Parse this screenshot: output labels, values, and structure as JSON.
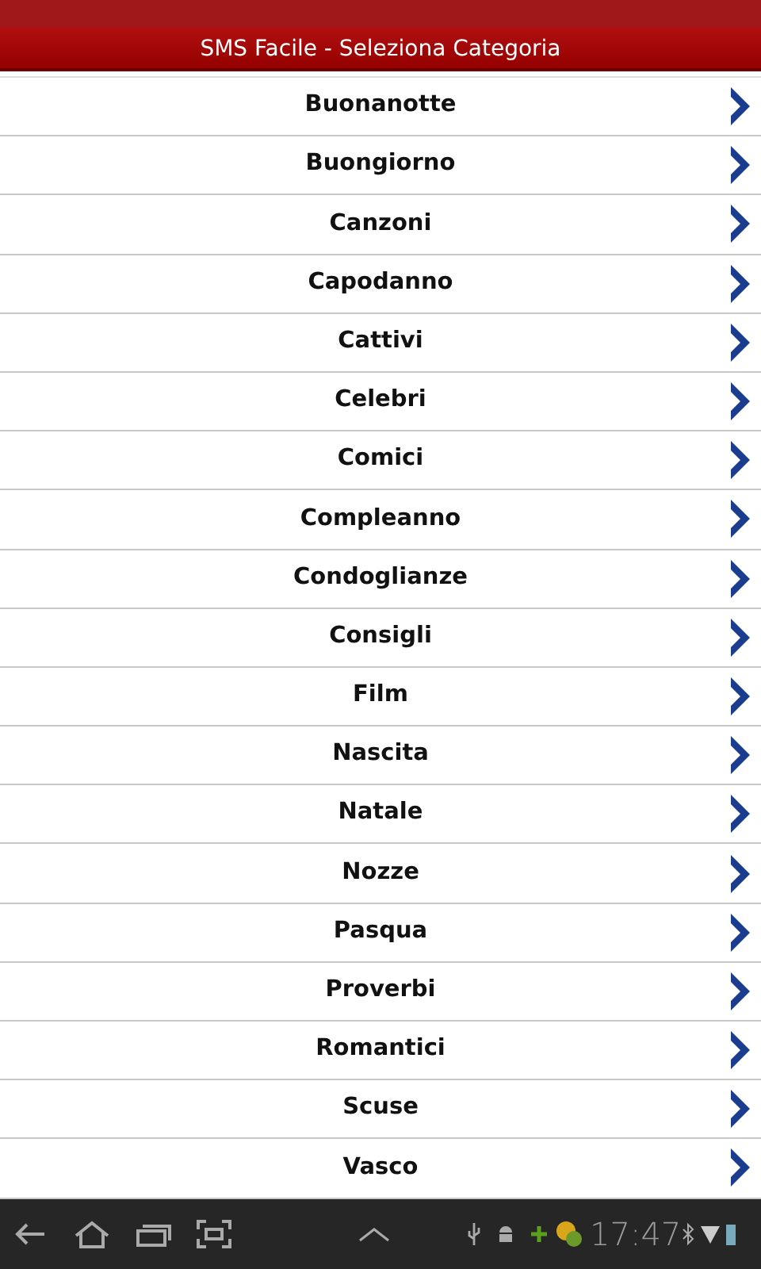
{
  "title_bar": {
    "title": "SMS Facile - Seleziona Categoria"
  },
  "categories": [
    {
      "label": "Buonanotte"
    },
    {
      "label": "Buongiorno"
    },
    {
      "label": "Canzoni"
    },
    {
      "label": "Capodanno"
    },
    {
      "label": "Cattivi"
    },
    {
      "label": "Celebri"
    },
    {
      "label": "Comici"
    },
    {
      "label": "Compleanno"
    },
    {
      "label": "Condoglianze"
    },
    {
      "label": "Consigli"
    },
    {
      "label": "Film"
    },
    {
      "label": "Nascita"
    },
    {
      "label": "Natale"
    },
    {
      "label": "Nozze"
    },
    {
      "label": "Pasqua"
    },
    {
      "label": "Proverbi"
    },
    {
      "label": "Romantici"
    },
    {
      "label": "Scuse"
    },
    {
      "label": "Vasco"
    }
  ],
  "system_bar": {
    "time": "17:47"
  }
}
